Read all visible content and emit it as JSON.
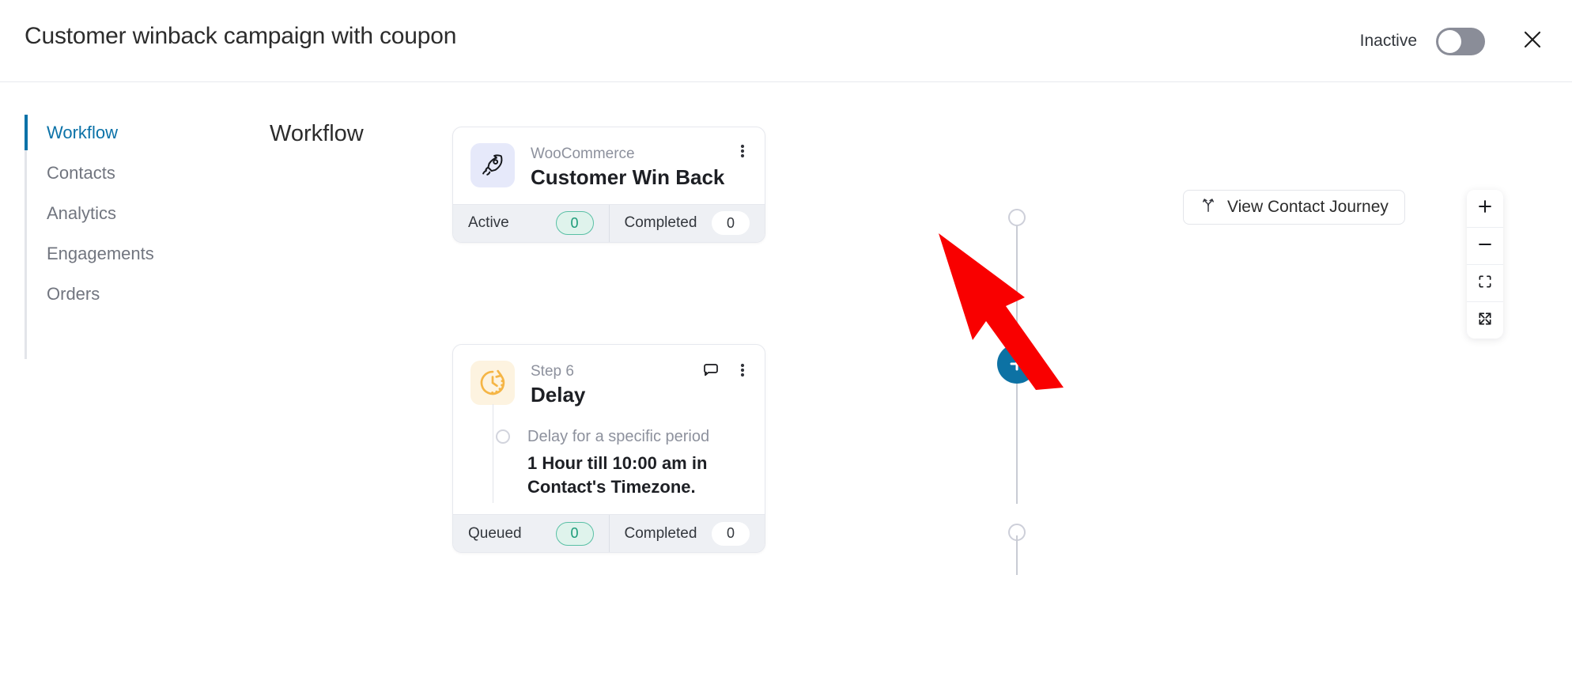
{
  "header": {
    "title": "Customer winback campaign with coupon",
    "status_label": "Inactive",
    "toggle_state": "off",
    "close_icon": "close-icon"
  },
  "sidebar": {
    "items": [
      {
        "label": "Workflow",
        "active": true
      },
      {
        "label": "Contacts",
        "active": false
      },
      {
        "label": "Analytics",
        "active": false
      },
      {
        "label": "Engagements",
        "active": false
      },
      {
        "label": "Orders",
        "active": false
      }
    ]
  },
  "main": {
    "heading": "Workflow",
    "journey_button": {
      "label": "View Contact Journey",
      "icon": "journey-branch-icon"
    },
    "zoom_controls": [
      {
        "name": "zoom-in-button",
        "icon": "plus-icon"
      },
      {
        "name": "zoom-out-button",
        "icon": "minus-icon"
      },
      {
        "name": "fit-view-button",
        "icon": "fit-frame-icon"
      },
      {
        "name": "fullscreen-button",
        "icon": "expand-arrows-icon"
      }
    ],
    "add_step_button": {
      "icon": "plus-icon",
      "label": "+"
    }
  },
  "nodes": [
    {
      "id": "trigger",
      "icon": "rocket-icon",
      "icon_bg": "#e6e9fa",
      "eyebrow": "WooCommerce",
      "title": "Customer Win Back",
      "menu_icon": "kebab-menu-icon",
      "footer": [
        {
          "label": "Active",
          "value": "0",
          "style": "green"
        },
        {
          "label": "Completed",
          "value": "0",
          "style": "white"
        }
      ]
    },
    {
      "id": "delay",
      "icon": "clock-icon",
      "icon_bg": "#fdf3e0",
      "eyebrow": "Step 6",
      "title": "Delay",
      "comment_icon": "comment-bubble-icon",
      "menu_icon": "kebab-menu-icon",
      "body_sub": "Delay for a specific period",
      "body_main": "1 Hour till 10:00 am in Contact's Timezone.",
      "footer": [
        {
          "label": "Queued",
          "value": "0",
          "style": "green"
        },
        {
          "label": "Completed",
          "value": "0",
          "style": "white"
        }
      ]
    }
  ],
  "annotation": {
    "type": "red-arrow",
    "color": "#f90000",
    "points_to": "completed-pill-of-trigger-node"
  },
  "colors": {
    "accent_blue": "#0b72a8",
    "pill_green_text": "#1a9b78",
    "pill_green_bg": "#dff3ec",
    "footer_bg": "#eef0f4",
    "annotation_red": "#f90000"
  }
}
